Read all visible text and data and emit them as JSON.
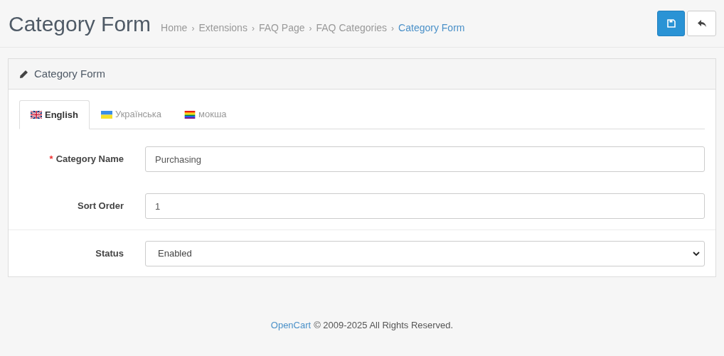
{
  "header": {
    "title": "Category Form",
    "breadcrumbs": [
      {
        "label": "Home",
        "current": false
      },
      {
        "label": "Extensions",
        "current": false
      },
      {
        "label": "FAQ Page",
        "current": false
      },
      {
        "label": "FAQ Categories",
        "current": false
      },
      {
        "label": "Category Form",
        "current": true
      }
    ],
    "separator": "›"
  },
  "card": {
    "title": "Category Form",
    "tabs": [
      {
        "label": "English",
        "kind": "uk",
        "selected": true
      },
      {
        "label": "Українська",
        "kind": "ua",
        "selected": false
      },
      {
        "label": "мокша",
        "kind": "rainbow",
        "selected": false
      }
    ],
    "fields": [
      {
        "label": "Category Name",
        "kind": "text",
        "required_mark": "*",
        "value": "Purchasing"
      },
      {
        "label": "Sort Order",
        "kind": "text",
        "value": "1"
      },
      {
        "label": "Status",
        "kind": "select",
        "value": "Enabled"
      }
    ]
  },
  "footer": {
    "link": "OpenCart",
    "text": "© 2009-2025 All Rights Reserved."
  }
}
